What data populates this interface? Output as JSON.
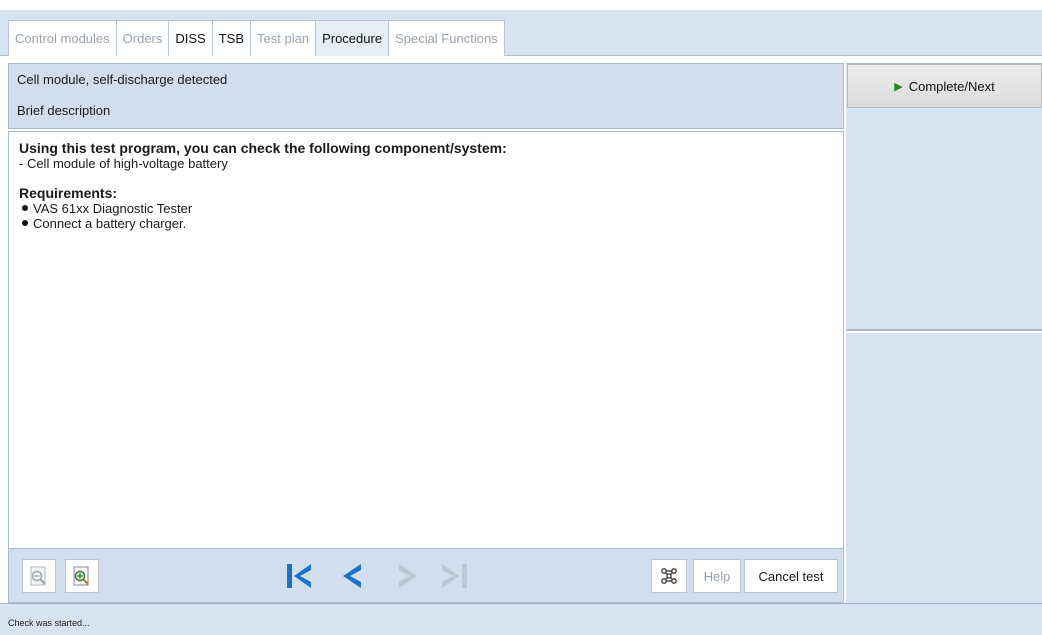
{
  "tabs": [
    {
      "label": "Control modules",
      "state": "disabled"
    },
    {
      "label": "Orders",
      "state": "disabled"
    },
    {
      "label": "DISS",
      "state": "enabled"
    },
    {
      "label": "TSB",
      "state": "enabled"
    },
    {
      "label": "Test plan",
      "state": "disabled"
    },
    {
      "label": "Procedure",
      "state": "active"
    },
    {
      "label": "Special Functions",
      "state": "disabled"
    }
  ],
  "procedure": {
    "title": "Cell module, self-discharge detected",
    "subtitle": "Brief description"
  },
  "content": {
    "heading": "Using this test program, you can check the following component/system:",
    "line1": "- Cell module of high-voltage battery",
    "req_heading": "Requirements:",
    "requirements": [
      "VAS 61xx Diagnostic Tester",
      "Connect a battery charger."
    ]
  },
  "toolbar": {
    "help_label": "Help",
    "cancel_label": "Cancel test"
  },
  "side": {
    "complete_label": "Complete/Next"
  },
  "status": {
    "text": "Check was started..."
  },
  "colors": {
    "panel_blue": "#d6e3f1",
    "nav_blue": "#1a73c9",
    "nav_disabled": "#b9c6d4"
  },
  "icons": [
    "zoom-out-icon",
    "zoom-in-icon",
    "first-icon",
    "previous-icon",
    "next-icon",
    "last-icon",
    "network-icon",
    "play-icon"
  ]
}
